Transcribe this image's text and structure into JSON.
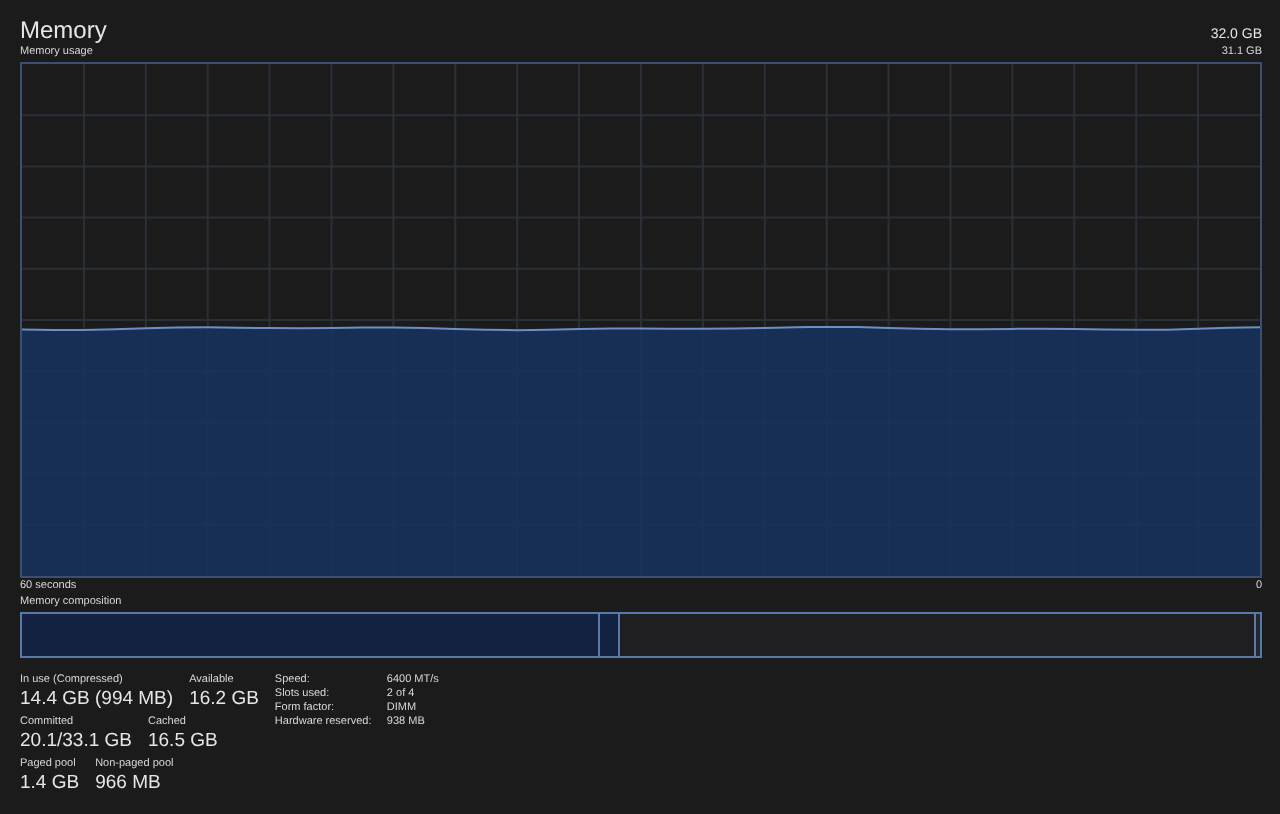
{
  "header": {
    "title": "Memory",
    "capacity": "32.0 GB"
  },
  "graph": {
    "label": "Memory usage",
    "max": "31.1 GB",
    "left_caption": "60 seconds",
    "right_caption": "0"
  },
  "composition": {
    "label": "Memory composition",
    "segments": [
      {
        "kind": "in_use",
        "level": 0.466
      },
      {
        "kind": "modified",
        "level": 0.016
      },
      {
        "kind": "standby",
        "level": 0.513
      },
      {
        "kind": "free",
        "level": 0.005
      }
    ]
  },
  "stats": [
    [
      {
        "label": "In use (Compressed)",
        "value": "14.4 GB (994 MB)"
      },
      {
        "label": "Available",
        "value": "16.2 GB"
      }
    ],
    [
      {
        "label": "Committed",
        "value": "20.1/33.1 GB"
      },
      {
        "label": "Cached",
        "value": "16.5 GB"
      }
    ],
    [
      {
        "label": "Paged pool",
        "value": "1.4 GB"
      },
      {
        "label": "Non-paged pool",
        "value": "966 MB"
      }
    ]
  ],
  "details": [
    {
      "label": "Speed:",
      "value": "6400 MT/s"
    },
    {
      "label": "Slots used:",
      "value": "2 of 4"
    },
    {
      "label": "Form factor:",
      "value": "DIMM"
    },
    {
      "label": "Hardware reserved:",
      "value": "938 MB"
    }
  ]
}
